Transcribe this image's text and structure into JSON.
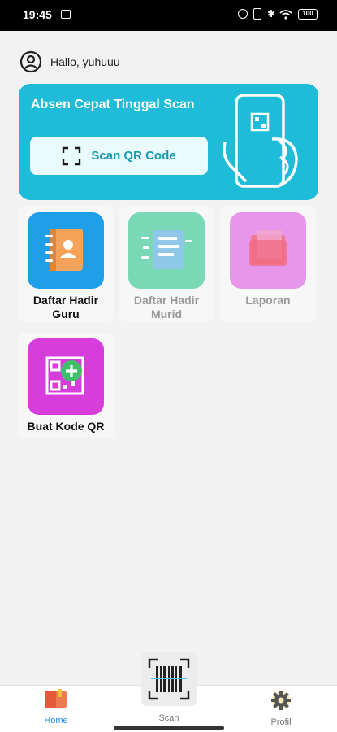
{
  "status_bar": {
    "time": "19:45",
    "battery": "100"
  },
  "greeting": {
    "text": "Hallo, yuhuuu"
  },
  "banner": {
    "title": "Absen Cepat Tinggal Scan",
    "button_label": "Scan QR Code"
  },
  "menu": [
    {
      "label": "Daftar Hadir Guru",
      "line1": "Daftar Hadir",
      "line2": "Guru",
      "enabled": true,
      "color": "#1e9fe8"
    },
    {
      "label": "Daftar Hadir Murid",
      "line1": "Daftar Hadir",
      "line2": "Murid",
      "enabled": false,
      "color": "#79d8b6"
    },
    {
      "label": "Laporan",
      "line1": "Laporan",
      "line2": "",
      "enabled": false,
      "color": "#e896ec"
    },
    {
      "label": "Buat Kode QR",
      "line1": "Buat Kode QR",
      "line2": "",
      "enabled": true,
      "color": "#d63ddb"
    }
  ],
  "bottom_nav": {
    "home": {
      "label": "Home",
      "active": true,
      "color": "#1e88e5"
    },
    "scan": {
      "label": "Scan"
    },
    "profil": {
      "label": "Profil"
    }
  },
  "colors": {
    "banner": "#1fbcd9",
    "banner_button_text": "#1a99b5"
  }
}
